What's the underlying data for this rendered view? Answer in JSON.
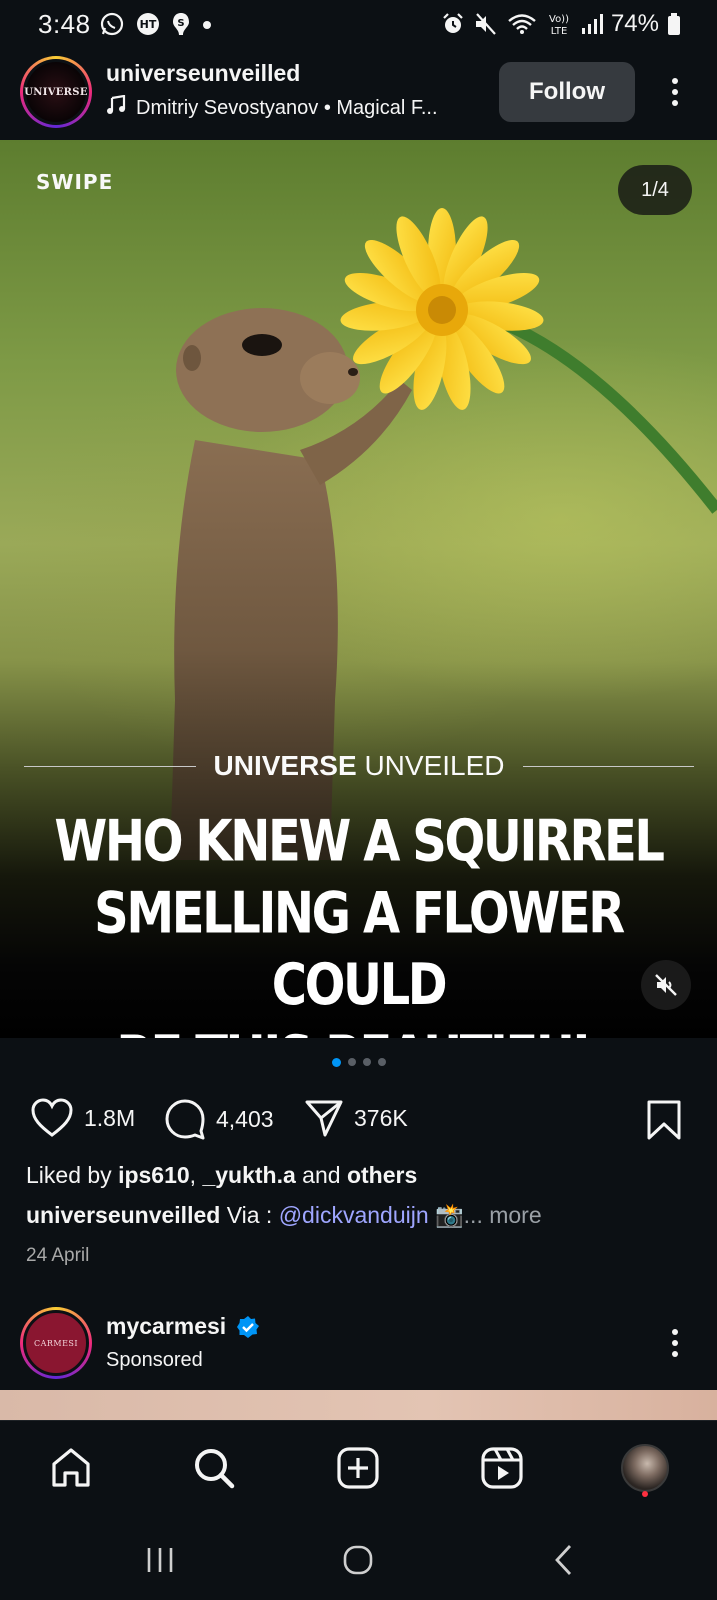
{
  "status_bar": {
    "time": "3:48",
    "battery": "74%",
    "left_icons": [
      "whatsapp-icon",
      "ht-icon",
      "app-icon",
      "dot-icon"
    ],
    "right_icons": [
      "alarm-icon",
      "mute-icon",
      "wifi-icon",
      "volte-icon",
      "signal-icon",
      "battery-icon"
    ]
  },
  "post": {
    "avatar_text": "UNIVERSE",
    "username": "universeunveilled",
    "audio": "Dmitriy Sevostyanov • Magical F...",
    "follow_label": "Follow",
    "media": {
      "swipe_label": "SWIPE",
      "counter": "1/4",
      "brand_bold": "UNIVERSE",
      "brand_light": "UNVEILED",
      "headline_lines": [
        "WHO KNEW A SQUIRREL",
        "SMELLING A FLOWER COULD",
        "BE THIS BEAUTIFUL"
      ]
    },
    "carousel": {
      "total": 4,
      "active": 0
    },
    "likes": "1.8M",
    "comments": "4,403",
    "shares": "376K",
    "liked_by": {
      "prefix": "Liked by ",
      "user1": "ips610",
      "sep": ", ",
      "user2": "_yukth.a",
      "and": " and ",
      "others": "others"
    },
    "caption": {
      "user": "universeunveilled",
      "text": " Via : ",
      "mention": "@dickvanduijn",
      "emoji": "📸",
      "more": "... more"
    },
    "date": "24 April"
  },
  "next_post": {
    "avatar_text": "CARMESI",
    "username": "mycarmesi",
    "verified": true,
    "subtitle": "Sponsored"
  },
  "colors": {
    "background": "#0c1014",
    "accent_blue": "#0095f6",
    "mention": "#9fa6ff",
    "follow_button": "#363a3f"
  }
}
